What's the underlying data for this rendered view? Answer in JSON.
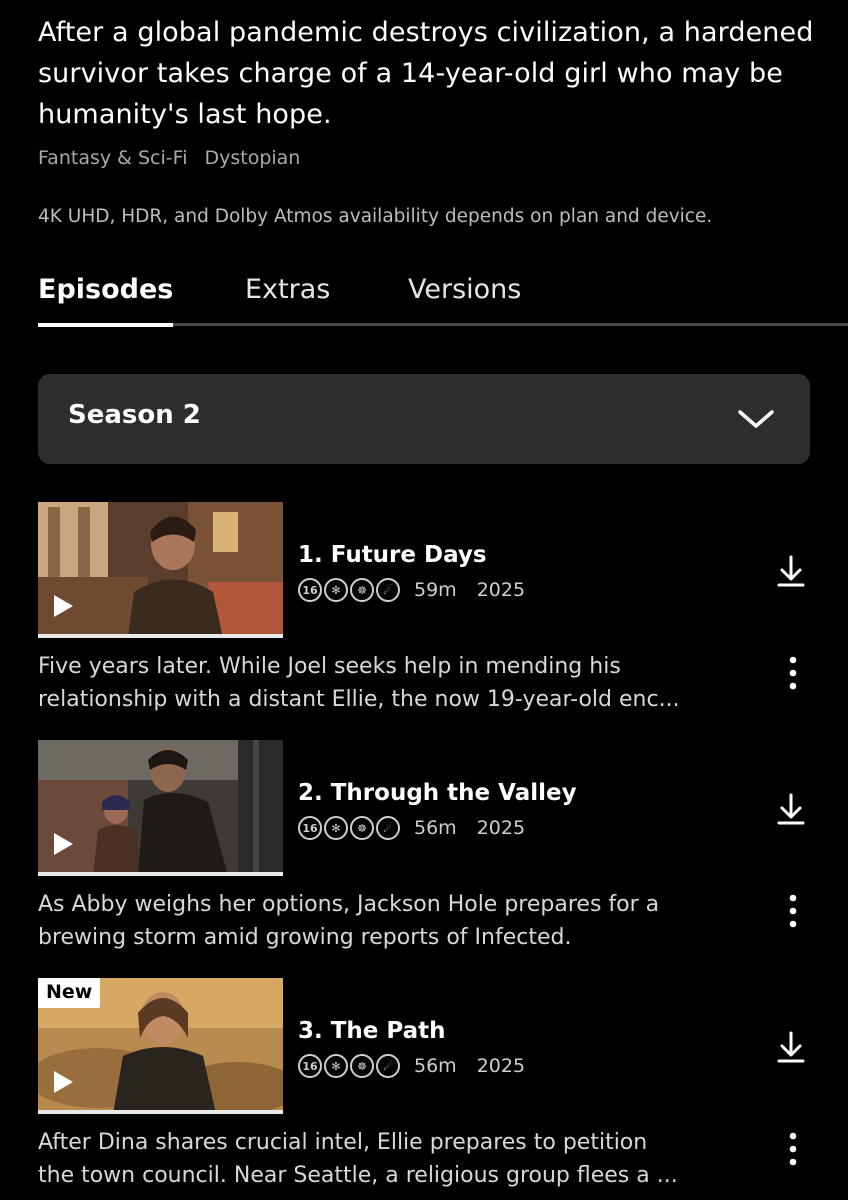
{
  "synopsis": "After a global pandemic destroys civilization, a hardened survivor takes charge of a 14-year-old girl who may be humanity's last hope.",
  "genres": [
    "Fantasy & Sci-Fi",
    "Dystopian"
  ],
  "availability_notice": "4K UHD, HDR, and Dolby Atmos availability depends on plan and device.",
  "tabs": [
    {
      "label": "Episodes",
      "active": true
    },
    {
      "label": "Extras",
      "active": false
    },
    {
      "label": "Versions",
      "active": false
    }
  ],
  "season_selector": {
    "label": "Season 2",
    "icon": "chevron-down-icon"
  },
  "episodes": [
    {
      "title": "1. Future Days",
      "rating": "16",
      "duration": "59m",
      "year": "2025",
      "new_badge": "",
      "description_line1": "Five years later. While Joel seeks help in mending his",
      "description_line2": "relationship with a distant Ellie, the now 19-year-old enc..."
    },
    {
      "title": "2. Through the Valley",
      "rating": "16",
      "duration": "56m",
      "year": "2025",
      "new_badge": "",
      "description_line1": "As Abby weighs her options, Jackson Hole prepares for a",
      "description_line2": "brewing storm amid growing reports of Infected."
    },
    {
      "title": "3. The Path",
      "rating": "16",
      "duration": "56m",
      "year": "2025",
      "new_badge": "New",
      "description_line1": "After Dina shares crucial intel, Ellie prepares to petition",
      "description_line2": "the town council. Near Seattle, a religious group flees a ..."
    }
  ],
  "colors": {
    "background": "#000000",
    "select_background": "#2e2e2e",
    "secondary_text": "#a9a9a9"
  }
}
